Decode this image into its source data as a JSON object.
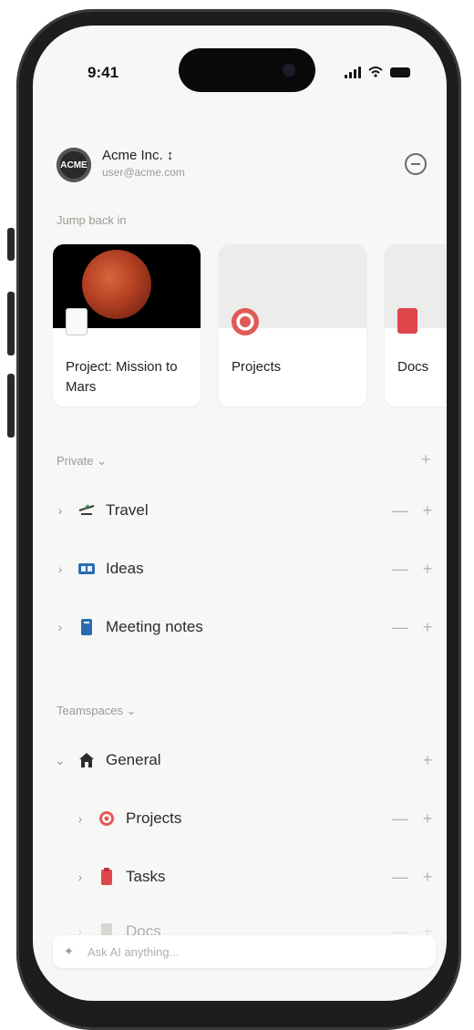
{
  "status_bar": {
    "time": "9:41"
  },
  "account": {
    "avatar_text": "ACME",
    "name": "Acme Inc. ↕",
    "email": "user@acme.com"
  },
  "jump_back": {
    "label": "Jump back in",
    "cards": [
      {
        "title": "Project: Mission to Mars",
        "icon": "page-icon"
      },
      {
        "title": "Projects",
        "icon": "target-icon"
      },
      {
        "title": "Docs",
        "icon": "docs-icon"
      }
    ]
  },
  "private": {
    "label": "Private ⌄",
    "add": "+",
    "items": [
      {
        "label": "Travel",
        "icon": "travel-icon",
        "chevron": "›",
        "more": "—",
        "add": "+"
      },
      {
        "label": "Ideas",
        "icon": "ideas-icon",
        "chevron": "›",
        "more": "—",
        "add": "+"
      },
      {
        "label": "Meeting notes",
        "icon": "notes-icon",
        "chevron": "›",
        "more": "—",
        "add": "+"
      }
    ]
  },
  "teamspaces": {
    "label": "Teamspaces ⌄",
    "general": {
      "label": "General",
      "chevron": "⌄",
      "add": "+"
    },
    "items": [
      {
        "label": "Projects",
        "icon": "target-icon",
        "chevron": "›",
        "more": "—",
        "add": "+"
      },
      {
        "label": "Tasks",
        "icon": "tasks-icon",
        "chevron": "›",
        "more": "—",
        "add": "+"
      },
      {
        "label": "Docs",
        "icon": "docs-icon",
        "chevron": "›",
        "more": "—",
        "add": "+"
      }
    ]
  },
  "ask": {
    "placeholder": "Ask AI anything..."
  },
  "colors": {
    "screen_bg": "#f7f7f5",
    "accent_red": "#e0474c",
    "muted_text": "#9b9a97"
  }
}
